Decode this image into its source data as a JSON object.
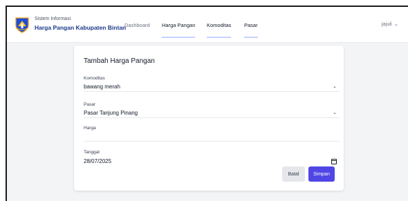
{
  "header": {
    "subtitle": "Sistem Informasi",
    "title": "Harga Pangan Kabupaten Bintan",
    "nav": {
      "dashboard": "Dashboard",
      "harga_pangan": "Harga Pangan",
      "komoditas": "Komoditas",
      "pasar": "Pasar"
    },
    "user": "jajuli",
    "user_caret": "⌄"
  },
  "form": {
    "title": "Tambah Harga Pangan",
    "komoditas_label": "Komoditas",
    "komoditas_value": "bawang merah",
    "pasar_label": "Pasar",
    "pasar_value": "Pasar Tanjung Pinang",
    "harga_label": "Harga",
    "harga_value": "",
    "tanggal_label": "Tanggal",
    "tanggal_value": "28/07/2025",
    "chevron": "⌄",
    "cancel_label": "Batal",
    "save_label": "Simpan"
  },
  "colors": {
    "brand": "#1e3a8a",
    "primary": "#4f46e5",
    "active_underline": "#c7d2fe"
  }
}
